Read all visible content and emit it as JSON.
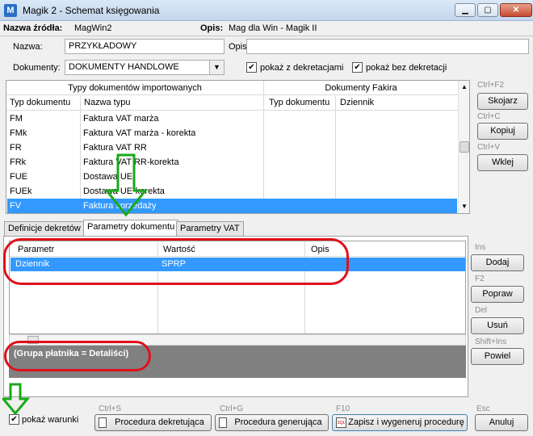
{
  "window": {
    "title": "Magik 2 - Schemat księgowania",
    "icon": "app-icon"
  },
  "source": {
    "name_label": "Nazwa źródła:",
    "name_value": "MagWin2",
    "desc_label": "Opis:",
    "desc_value": "Mag dla Win - Magik II"
  },
  "form": {
    "name_label": "Nazwa:",
    "name_value": "PRZYKŁADOWY",
    "opis_label": "Opis:",
    "opis_value": "",
    "documents_label": "Dokumenty:",
    "documents_value": "DOKUMENTY HANDLOWE",
    "show_with_label": "pokaż z dekretacjami",
    "show_with_checked": true,
    "show_without_label": "pokaż bez dekretacji",
    "show_without_checked": true
  },
  "doc_types": {
    "group_imported": "Typy dokumentów importowanych",
    "group_fakir": "Dokumenty Fakira",
    "columns": [
      "Typ dokumentu",
      "Nazwa typu",
      "Typ dokumentu",
      "Dziennik"
    ],
    "rows": [
      [
        "FM",
        "Faktura VAT marża"
      ],
      [
        "FMk",
        "Faktura VAT marża - korekta"
      ],
      [
        "FR",
        "Faktura VAT RR"
      ],
      [
        "FRk",
        "Faktura VAT RR-korekta"
      ],
      [
        "FUE",
        "Dostawa UE"
      ],
      [
        "FUEk",
        "Dostawa UE-korekta"
      ],
      [
        "FV",
        "Faktura sprzedaży"
      ]
    ],
    "selected_index": 6
  },
  "side_buttons_top": [
    {
      "shortcut": "Ctrl+F2",
      "label": "Skojarz"
    },
    {
      "shortcut": "Ctrl+C",
      "label": "Kopiuj"
    },
    {
      "shortcut": "Ctrl+V",
      "label": "Wklej"
    }
  ],
  "tabs": [
    "Definicje dekretów",
    "Parametry dokumentu",
    "Parametry VAT"
  ],
  "active_tab": 1,
  "params": {
    "columns": [
      "Parametr",
      "Wartość",
      "Opis"
    ],
    "rows": [
      [
        "Dziennik",
        "SPRP",
        ""
      ]
    ]
  },
  "side_buttons_bottom": [
    {
      "shortcut": "Ins",
      "label": "Dodaj"
    },
    {
      "shortcut": "F2",
      "label": "Popraw"
    },
    {
      "shortcut": "Del",
      "label": "Usuń"
    },
    {
      "shortcut": "Shift+Ins",
      "label": "Powiel"
    }
  ],
  "condition_text": "(Grupa płatnika = Detaliści)",
  "footer": {
    "show_conditions_label": "pokaż warunki",
    "show_conditions_checked": true,
    "buttons": [
      {
        "shortcut": "Ctrl+S",
        "label": "Procedura dekretująca",
        "icon": "document-icon"
      },
      {
        "shortcut": "Ctrl+G",
        "label": "Procedura generująca",
        "icon": "document-icon"
      },
      {
        "shortcut": "F10",
        "label": "Zapisz i wygeneruj procedurę",
        "icon": "sql-icon"
      },
      {
        "shortcut": "Esc",
        "label": "Anuluj",
        "icon": ""
      }
    ]
  },
  "colors": {
    "selection": "#3399ff",
    "annotation_red": "#e0101a",
    "annotation_green": "#1aa81a",
    "condition_bg": "#808080"
  }
}
